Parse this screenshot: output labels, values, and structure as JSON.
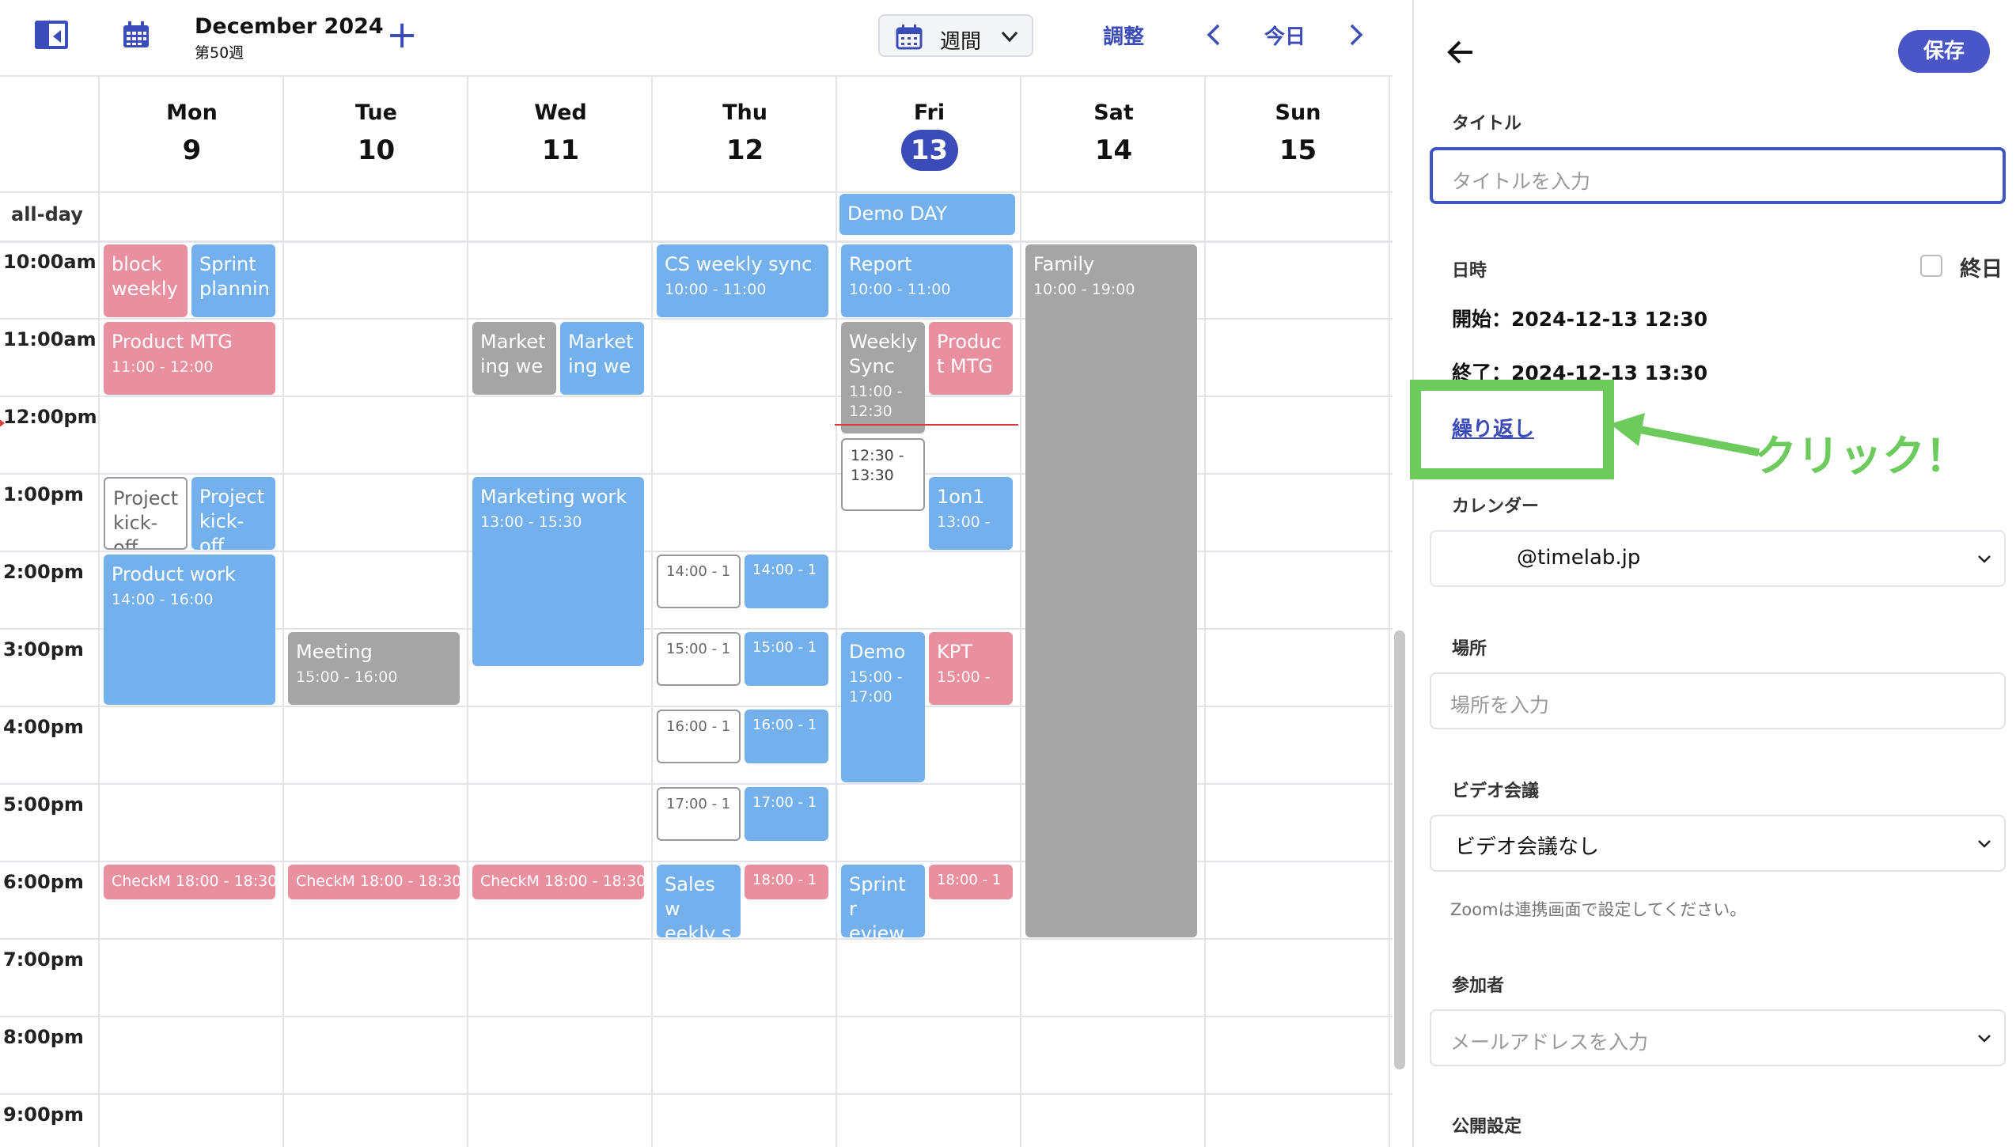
{
  "header": {
    "month_title": "December 2024",
    "week_label": "第50週",
    "add_label": "+",
    "view_select": "週間",
    "adjust_label": "調整",
    "today_label": "今日"
  },
  "calendar": {
    "allday_label": "all-day",
    "days": [
      {
        "name": "Mon",
        "num": "9"
      },
      {
        "name": "Tue",
        "num": "10"
      },
      {
        "name": "Wed",
        "num": "11"
      },
      {
        "name": "Thu",
        "num": "12"
      },
      {
        "name": "Fri",
        "num": "13",
        "today": true
      },
      {
        "name": "Sat",
        "num": "14"
      },
      {
        "name": "Sun",
        "num": "15"
      }
    ],
    "hours": [
      "10:00am",
      "11:00am",
      "12:00pm",
      "1:00pm",
      "2:00pm",
      "3:00pm",
      "4:00pm",
      "5:00pm",
      "6:00pm",
      "7:00pm",
      "8:00pm",
      "9:00pm"
    ],
    "events": [
      {
        "title": "Demo DAY",
        "time": ""
      },
      {
        "title": "block weekly",
        "time": ""
      },
      {
        "title": "Sprint plannin",
        "time": ""
      },
      {
        "title": "Product MTG",
        "time": "11:00 - 12:00"
      },
      {
        "title": "Project kick-off",
        "time": ""
      },
      {
        "title": "Project kick-off",
        "time": ""
      },
      {
        "title": "Product work",
        "time": "14:00 - 16:00"
      },
      {
        "title": "CheckM 18:00 - 18:30",
        "time": ""
      },
      {
        "title": "Meeting",
        "time": "15:00 - 16:00"
      },
      {
        "title": "CheckM 18:00 - 18:30",
        "time": ""
      },
      {
        "title": "Market ing we",
        "time": ""
      },
      {
        "title": "Market ing we",
        "time": ""
      },
      {
        "title": "Marketing work",
        "time": "13:00 - 15:30"
      },
      {
        "title": "CheckM 18:00 - 18:30",
        "time": ""
      },
      {
        "title": "CS weekly sync",
        "time": "10:00 - 11:00"
      },
      {
        "title": "14:00 - 1",
        "time": ""
      },
      {
        "title": "14:00 - 1",
        "time": ""
      },
      {
        "title": "15:00 - 1",
        "time": ""
      },
      {
        "title": "15:00 - 1",
        "time": ""
      },
      {
        "title": "16:00 - 1",
        "time": ""
      },
      {
        "title": "16:00 - 1",
        "time": ""
      },
      {
        "title": "17:00 - 1",
        "time": ""
      },
      {
        "title": "17:00 - 1",
        "time": ""
      },
      {
        "title": "Sales w eekly s",
        "time": ""
      },
      {
        "title": "18:00 - 1",
        "time": ""
      },
      {
        "title": "Report",
        "time": "10:00 - 11:00"
      },
      {
        "title": "Weekly Sync",
        "time": "11:00 - 12:30"
      },
      {
        "title": "Produc t MTG",
        "time": ""
      },
      {
        "title": "12:30 - 13:30",
        "time": ""
      },
      {
        "title": "1on1",
        "time": "13:00 -"
      },
      {
        "title": "Demo",
        "time": "15:00 - 17:00"
      },
      {
        "title": "KPT",
        "time": "15:00 -"
      },
      {
        "title": "Sprint r eview",
        "time": ""
      },
      {
        "title": "18:00 - 1",
        "time": ""
      },
      {
        "title": "Family",
        "time": "10:00 - 19:00"
      }
    ]
  },
  "panel": {
    "save_label": "保存",
    "title_label": "タイトル",
    "title_placeholder": "タイトルを入力",
    "datetime_label": "日時",
    "allday_label": "終日",
    "start_text": "開始：2024-12-13 12:30",
    "end_text": "終了：2024-12-13 13:30",
    "repeat_link": "繰り返し",
    "annotation_text": "クリック！",
    "calendar_label": "カレンダー",
    "calendar_value": "@timelab.jp",
    "location_label": "場所",
    "location_placeholder": "場所を入力",
    "video_label": "ビデオ会議",
    "video_value": "ビデオ会議なし",
    "video_note": "Zoomは連携画面で設定してください。",
    "attendees_label": "参加者",
    "attendees_placeholder": "メールアドレスを入力",
    "visibility_label": "公開設定"
  },
  "colors": {
    "accent": "#3b4bb8",
    "event_blue": "#74b0ec",
    "event_pink": "#e88fa0",
    "event_gray": "#a5a5a5",
    "annotation_green": "#6ccb5c"
  }
}
